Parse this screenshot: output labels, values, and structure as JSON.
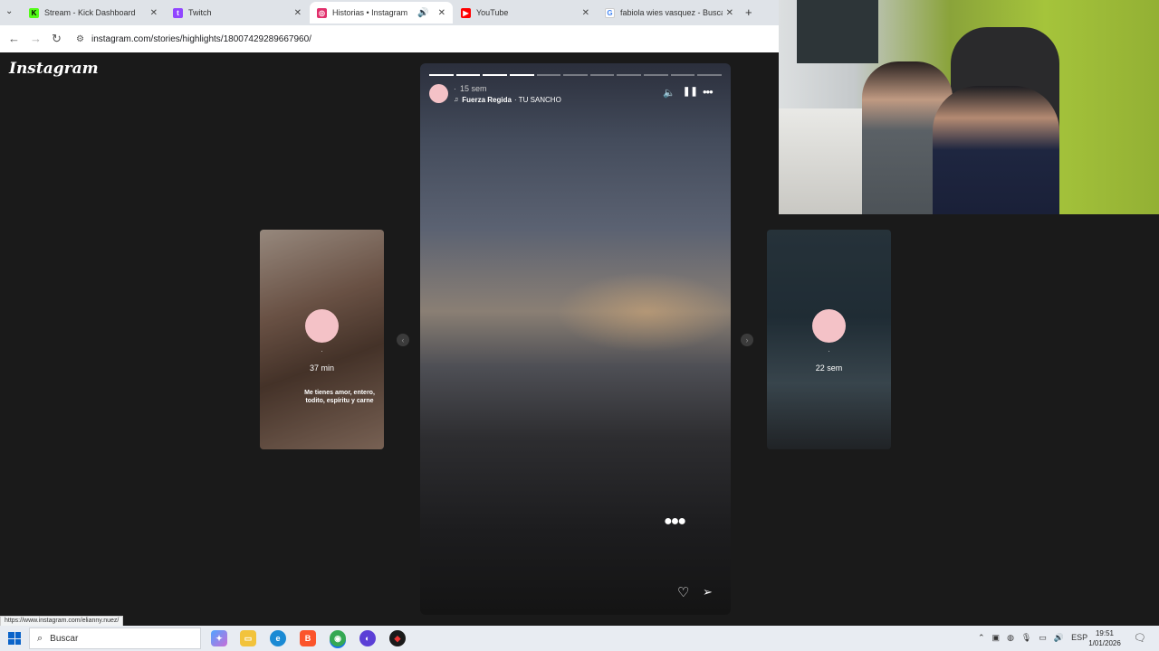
{
  "browser": {
    "tabs": [
      {
        "label": "Stream - Kick Dashboard",
        "favicon": "kick-icon",
        "color": "#53fc18",
        "active": false
      },
      {
        "label": "Twitch",
        "favicon": "twitch-icon",
        "color": "#9146ff",
        "active": false
      },
      {
        "label": "Historias • Instagram",
        "favicon": "instagram-icon",
        "color": "#e1306c",
        "active": true
      },
      {
        "label": "YouTube",
        "favicon": "youtube-icon",
        "color": "#ff0000",
        "active": false
      },
      {
        "label": "fabiola wies vasquez - Buscar c",
        "favicon": "google-icon",
        "color": "#4285f4",
        "active": false
      }
    ],
    "url": "instagram.com/stories/highlights/18007429289667960/"
  },
  "instagram": {
    "logo": "Instagram",
    "prev_story": {
      "dot": "·",
      "time": "37 min",
      "caption": "Me tienes amor, entero, todito, espíritu y carne"
    },
    "current_story": {
      "dot": "·",
      "time": "15 sem",
      "artist": "Fuerza Regida",
      "song": "· TU SANCHO",
      "progress_segments_total": 11,
      "progress_segments_done": 4
    },
    "next_story": {
      "dot": "·",
      "time": "22 sem"
    }
  },
  "status_bar": {
    "link": "https://www.instagram.com/elianny.nuez/"
  },
  "taskbar": {
    "search_placeholder": "Buscar",
    "language": "ESP",
    "time": "19:51",
    "date": "1/01/2026"
  }
}
